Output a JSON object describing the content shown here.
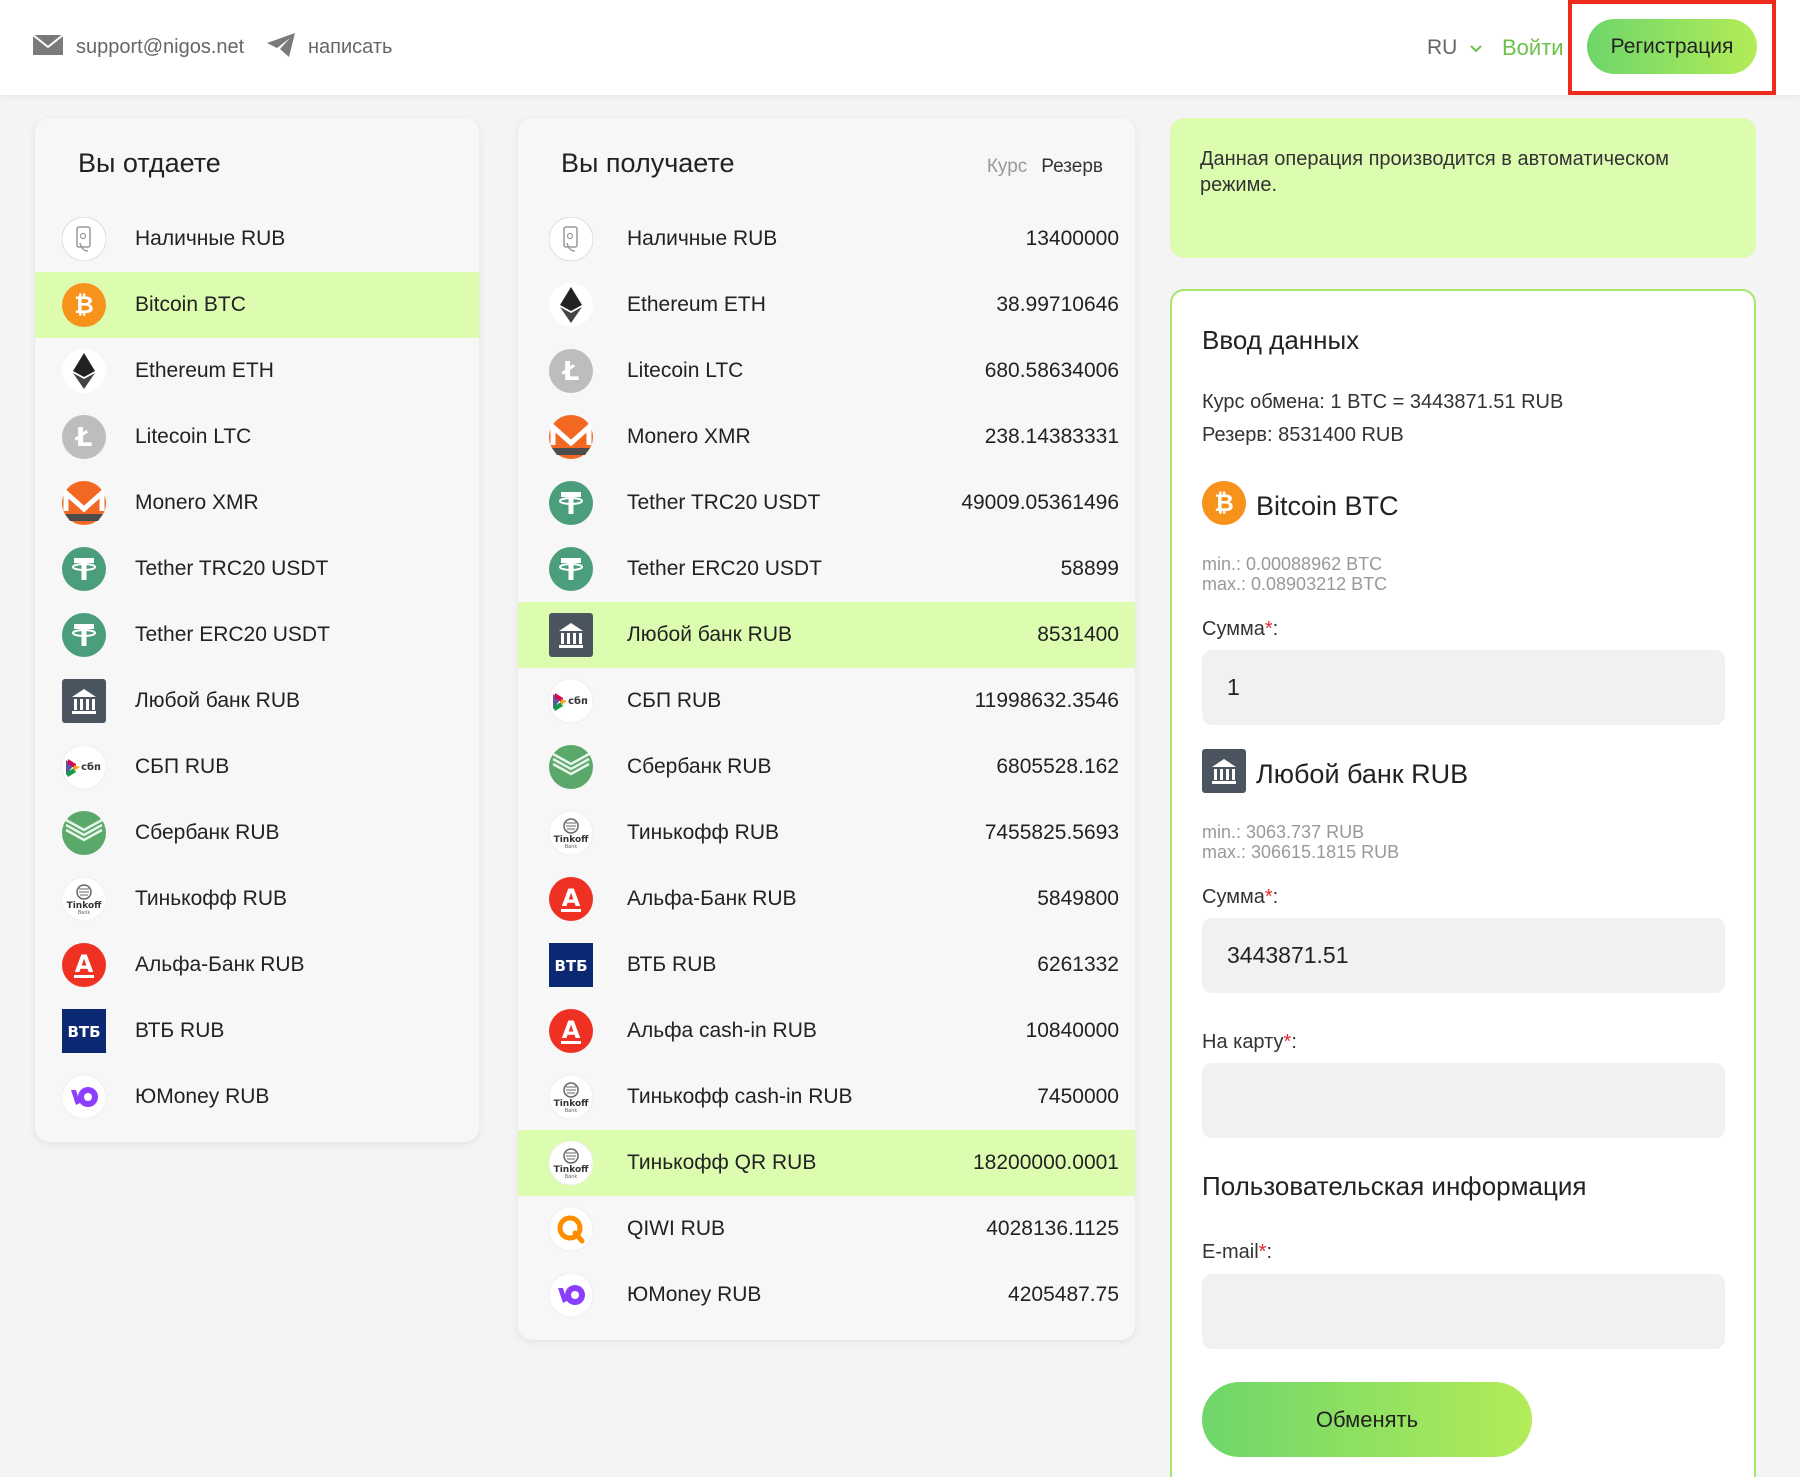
{
  "header": {
    "email": "support@nigos.net",
    "telegram_label": "написать",
    "lang": "RU",
    "login_label": "Войти",
    "register_label": "Регистрация"
  },
  "give": {
    "title": "Вы отдаете",
    "items": [
      {
        "name": "Наличные RUB",
        "icon": "cash-icon",
        "active": false
      },
      {
        "name": "Bitcoin BTC",
        "icon": "bitcoin-icon",
        "active": true
      },
      {
        "name": "Ethereum ETH",
        "icon": "ethereum-icon",
        "active": false
      },
      {
        "name": "Litecoin LTC",
        "icon": "litecoin-icon",
        "active": false
      },
      {
        "name": "Monero XMR",
        "icon": "monero-icon",
        "active": false
      },
      {
        "name": "Tether TRC20 USDT",
        "icon": "tether-icon",
        "active": false
      },
      {
        "name": "Tether ERC20 USDT",
        "icon": "tether-icon",
        "active": false
      },
      {
        "name": "Любой банк RUB",
        "icon": "bank-icon",
        "active": false
      },
      {
        "name": "СБП RUB",
        "icon": "sbp-icon",
        "active": false
      },
      {
        "name": "Сбербанк RUB",
        "icon": "sberbank-icon",
        "active": false
      },
      {
        "name": "Тинькофф RUB",
        "icon": "tinkoff-icon",
        "active": false
      },
      {
        "name": "Альфа-Банк RUB",
        "icon": "alfa-icon",
        "active": false
      },
      {
        "name": "ВТБ RUB",
        "icon": "vtb-icon",
        "active": false
      },
      {
        "name": "ЮMoney RUB",
        "icon": "yoomoney-icon",
        "active": false
      }
    ]
  },
  "receive": {
    "title": "Вы получаете",
    "col_rate": "Курс",
    "col_reserve": "Резерв",
    "items": [
      {
        "name": "Наличные RUB",
        "reserve": "13400000",
        "icon": "cash-icon",
        "active": false
      },
      {
        "name": "Ethereum ETH",
        "reserve": "38.99710646",
        "icon": "ethereum-icon",
        "active": false
      },
      {
        "name": "Litecoin LTC",
        "reserve": "680.58634006",
        "icon": "litecoin-icon",
        "active": false
      },
      {
        "name": "Monero XMR",
        "reserve": "238.14383331",
        "icon": "monero-icon",
        "active": false
      },
      {
        "name": "Tether TRC20 USDT",
        "reserve": "49009.05361496",
        "icon": "tether-icon",
        "active": false
      },
      {
        "name": "Tether ERC20 USDT",
        "reserve": "58899",
        "icon": "tether-icon",
        "active": false
      },
      {
        "name": "Любой банк RUB",
        "reserve": "8531400",
        "icon": "bank-icon",
        "active": true
      },
      {
        "name": "СБП RUB",
        "reserve": "11998632.3546",
        "icon": "sbp-icon",
        "active": false
      },
      {
        "name": "Сбербанк RUB",
        "reserve": "6805528.162",
        "icon": "sberbank-icon",
        "active": false
      },
      {
        "name": "Тинькофф RUB",
        "reserve": "7455825.5693",
        "icon": "tinkoff-icon",
        "active": false
      },
      {
        "name": "Альфа-Банк RUB",
        "reserve": "5849800",
        "icon": "alfa-icon",
        "active": false
      },
      {
        "name": "ВТБ RUB",
        "reserve": "6261332",
        "icon": "vtb-icon",
        "active": false
      },
      {
        "name": "Альфа cash-in RUB",
        "reserve": "10840000",
        "icon": "alfa-icon",
        "active": false
      },
      {
        "name": "Тинькофф cash-in RUB",
        "reserve": "7450000",
        "icon": "tinkoff-icon",
        "active": false
      },
      {
        "name": "Тинькофф QR RUB",
        "reserve": "18200000.0001",
        "icon": "tinkoff-icon",
        "active": true
      },
      {
        "name": "QIWI RUB",
        "reserve": "4028136.1125",
        "icon": "qiwi-icon",
        "active": false
      },
      {
        "name": "ЮMoney RUB",
        "reserve": "4205487.75",
        "icon": "yoomoney-icon",
        "active": false
      }
    ]
  },
  "info": {
    "text": "Данная операция производится в автоматическом режиме."
  },
  "form": {
    "title": "Ввод данных",
    "rate_line": "Курс обмена: 1 BTC = 3443871.51 RUB",
    "reserve_line": "Резерв: 8531400 RUB",
    "give_currency": "Bitcoin BTC",
    "give_min": "min.: 0.00088962 BTC",
    "give_max": "max.: 0.08903212 BTC",
    "give_amount_label": "Сумма",
    "give_amount_value": "1",
    "get_currency": "Любой банк RUB",
    "get_min": "min.: 3063.737 RUB",
    "get_max": "max.: 306615.1815 RUB",
    "get_amount_label": "Сумма",
    "get_amount_value": "3443871.51",
    "card_label": "На карту",
    "card_value": "",
    "user_section_title": "Пользовательская информация",
    "email_label": "E-mail",
    "email_value": "",
    "required_mark": "*",
    "submit_label": "Обменять"
  },
  "colors": {
    "accent_green": "#6cc14a",
    "active_row": "#dcfdb0",
    "highlight_outline": "#ee2a1a",
    "bitcoin": "#f7931a",
    "tether": "#4a9e7b",
    "bank": "#4a5560",
    "alfa": "#ef3124",
    "vtb": "#0a2972",
    "yoomoney": "#8b3ffd"
  }
}
